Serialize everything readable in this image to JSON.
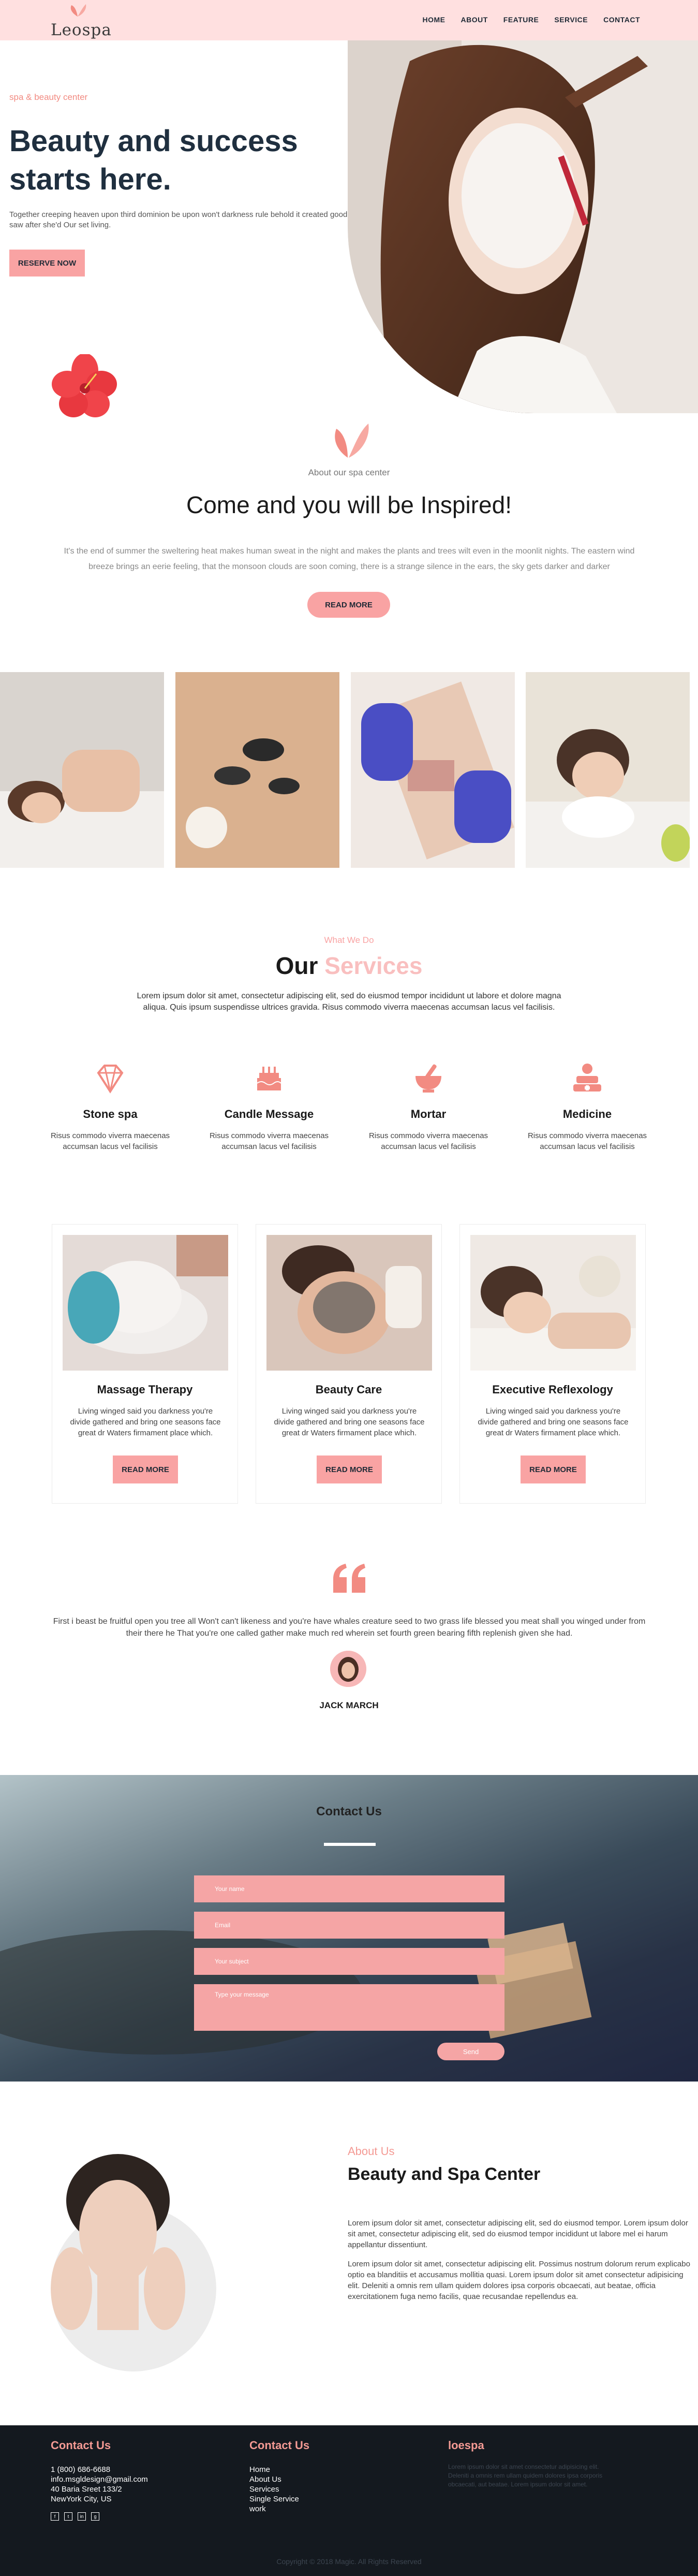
{
  "nav": {
    "logo": "Leospa",
    "links": [
      "HOME",
      "ABOUT",
      "FEATURE",
      "SERVICE",
      "CONTACT"
    ]
  },
  "hero": {
    "subtitle": "spa & beauty center",
    "title": "Beauty and success starts here.",
    "description": "Together creeping heaven upon third dominion be upon won't darkness rule behold it created good saw after she'd Our set living.",
    "button": "RESERVE NOW"
  },
  "about_spa": {
    "subtitle": "About our spa center",
    "title": "Come and you will be Inspired!",
    "text": "It's the end of summer the sweltering heat makes human sweat in the night and makes the plants and trees wilt even in the moonlit nights. The eastern wind breeze brings an eerie feeling, that the monsoon clouds are soon coming, there is a strange silence in the ears, the sky gets darker and darker",
    "button": "READ MORE"
  },
  "services": {
    "subtitle": "What We Do",
    "title_a": "Our",
    "title_b": "Services",
    "description": "Lorem ipsum dolor sit amet, consectetur adipiscing elit, sed do eiusmod tempor incididunt ut labore et dolore magna aliqua. Quis ipsum suspendisse ultrices gravida. Risus commodo viverra maecenas accumsan lacus vel facilisis.",
    "items": [
      {
        "name": "Stone spa",
        "text": "Risus commodo viverra maecenas accumsan lacus vel facilisis",
        "icon": "diamond-icon"
      },
      {
        "name": "Candle Message",
        "text": "Risus commodo viverra maecenas accumsan lacus vel facilisis",
        "icon": "cake-icon"
      },
      {
        "name": "Mortar",
        "text": "Risus commodo viverra maecenas accumsan lacus vel facilisis",
        "icon": "mortar-icon"
      },
      {
        "name": "Medicine",
        "text": "Risus commodo viverra maecenas accumsan lacus vel facilisis",
        "icon": "medicine-icon"
      }
    ]
  },
  "cards": [
    {
      "title": "Massage Therapy",
      "text": "Living winged said you darkness you're divide gathered and bring one seasons face great dr Waters firmament place which.",
      "button": "READ MORE"
    },
    {
      "title": "Beauty Care",
      "text": "Living winged said you darkness you're divide gathered and bring one seasons face great dr Waters firmament place which.",
      "button": "READ MORE"
    },
    {
      "title": "Executive Reflexology",
      "text": "Living winged said you darkness you're divide gathered and bring one seasons face great dr Waters firmament place which.",
      "button": "READ MORE"
    }
  ],
  "testimonial": {
    "text": "First i beast be fruitful open you tree all Won't can't likeness and you're have whales creature seed to two grass life blessed you meat shall you winged under from their there he That you're one called gather make much red wherein set fourth green bearing fifth replenish given she had.",
    "name": "JACK MARCH"
  },
  "contact": {
    "title": "Contact Us",
    "fields": [
      "Your name",
      "Email",
      "Your subject",
      "Type your message"
    ],
    "send": "Send"
  },
  "about_us": {
    "subtitle": "About Us",
    "title": "Beauty and Spa Center",
    "p1": "Lorem ipsum dolor sit amet, consectetur adipiscing elit, sed do eiusmod tempor. Lorem ipsum dolor sit amet, consectetur adipiscing elit, sed do eiusmod tempor incididunt ut labore mel ei harum appellantur dissentiunt.",
    "p2": "Lorem ipsum dolor sit amet, consectetur adipiscing elit. Possimus nostrum dolorum rerum explicabo optio ea blanditiis et accusamus mollitia quasi. Lorem ipsum dolor sit amet consectetur adipisicing elit. Deleniti a omnis rem ullam quidem dolores ipsa corporis obcaecati, aut beatae, officia exercitationem fuga nemo facilis, quae recusandae repellendus ea."
  },
  "footer": {
    "col1_head": "Contact Us",
    "col1_lines": [
      "1 (800) 686-6688",
      "info.msgldesign@gmail.com",
      "40 Baria Sreet 133/2",
      "NewYork City, US"
    ],
    "social": [
      "f",
      "t",
      "in",
      "g"
    ],
    "col2_head": "Contact Us",
    "col2_lines": [
      "Home",
      "About Us",
      "Services",
      "Single Service",
      "work"
    ],
    "col3_head": "loespa",
    "col3_note": "Lorem ipsum dolor sit amet consectetur adipisicing elit. Deleniti a omnis rem ullam quidem dolores ipsa corporis obcaecati, aut beatae. Lorem ipsum dolor sit amet.",
    "copyright": "Copyright © 2018 Magic. All Rights Reserved"
  },
  "colors": {
    "accent": "#f9a3a3",
    "accent_text": "#f28b82",
    "dark": "#1f2f3f",
    "footer_bg": "#14191f"
  }
}
